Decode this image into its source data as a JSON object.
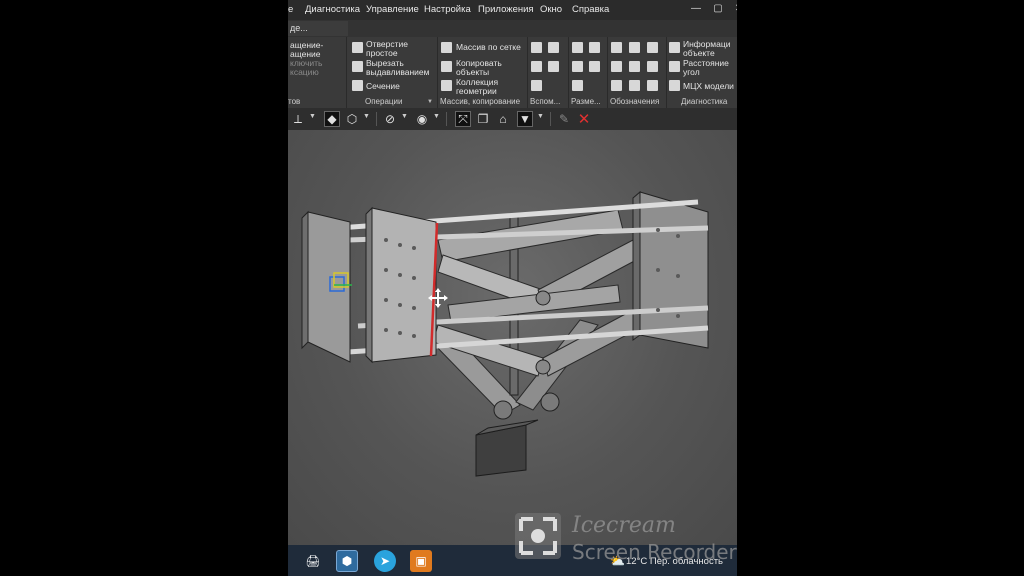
{
  "menubar": {
    "items": [
      "e",
      "Диагностика",
      "Управление",
      "Настройка",
      "Приложения",
      "Окно",
      "Справка"
    ],
    "window_buttons": [
      "—",
      "▢",
      "✕"
    ]
  },
  "doc_tab": {
    "label": "де..."
  },
  "ribbon": {
    "group1": {
      "items": [
        "ащение-",
        "ащение",
        "ключить",
        "ксацию"
      ],
      "label": "тов"
    },
    "operations": {
      "buttons": [
        "Отверстие",
        "простое",
        "Вырезать",
        "выдавливанием",
        "Сечение"
      ],
      "label": "Операции"
    },
    "array": {
      "buttons": [
        "Массив по сетке",
        "Копировать",
        "объекты",
        "Коллекция",
        "геометрии"
      ],
      "label": "Массив, копирование"
    },
    "aux": {
      "label": "Вспом..."
    },
    "dims": {
      "label": "Разме..."
    },
    "notation": {
      "label": "Обозначения"
    },
    "diagnostics": {
      "buttons": [
        "Информаци",
        "объекте",
        "Расстояние",
        "угол",
        "МЦХ модели"
      ],
      "label": "Диагностика"
    }
  },
  "taskbar": {
    "weather_temp": "12°C",
    "weather_desc": "Пер. облачность"
  },
  "watermark": {
    "brand": "Icecream",
    "product": "Screen Recorder"
  },
  "colors": {
    "background": "#4a4a4a",
    "menubar": "#2b2b2b",
    "ribbon": "#3a3a3a",
    "accent_red": "#d22b2b",
    "taskbar": "#1f2b3a"
  }
}
